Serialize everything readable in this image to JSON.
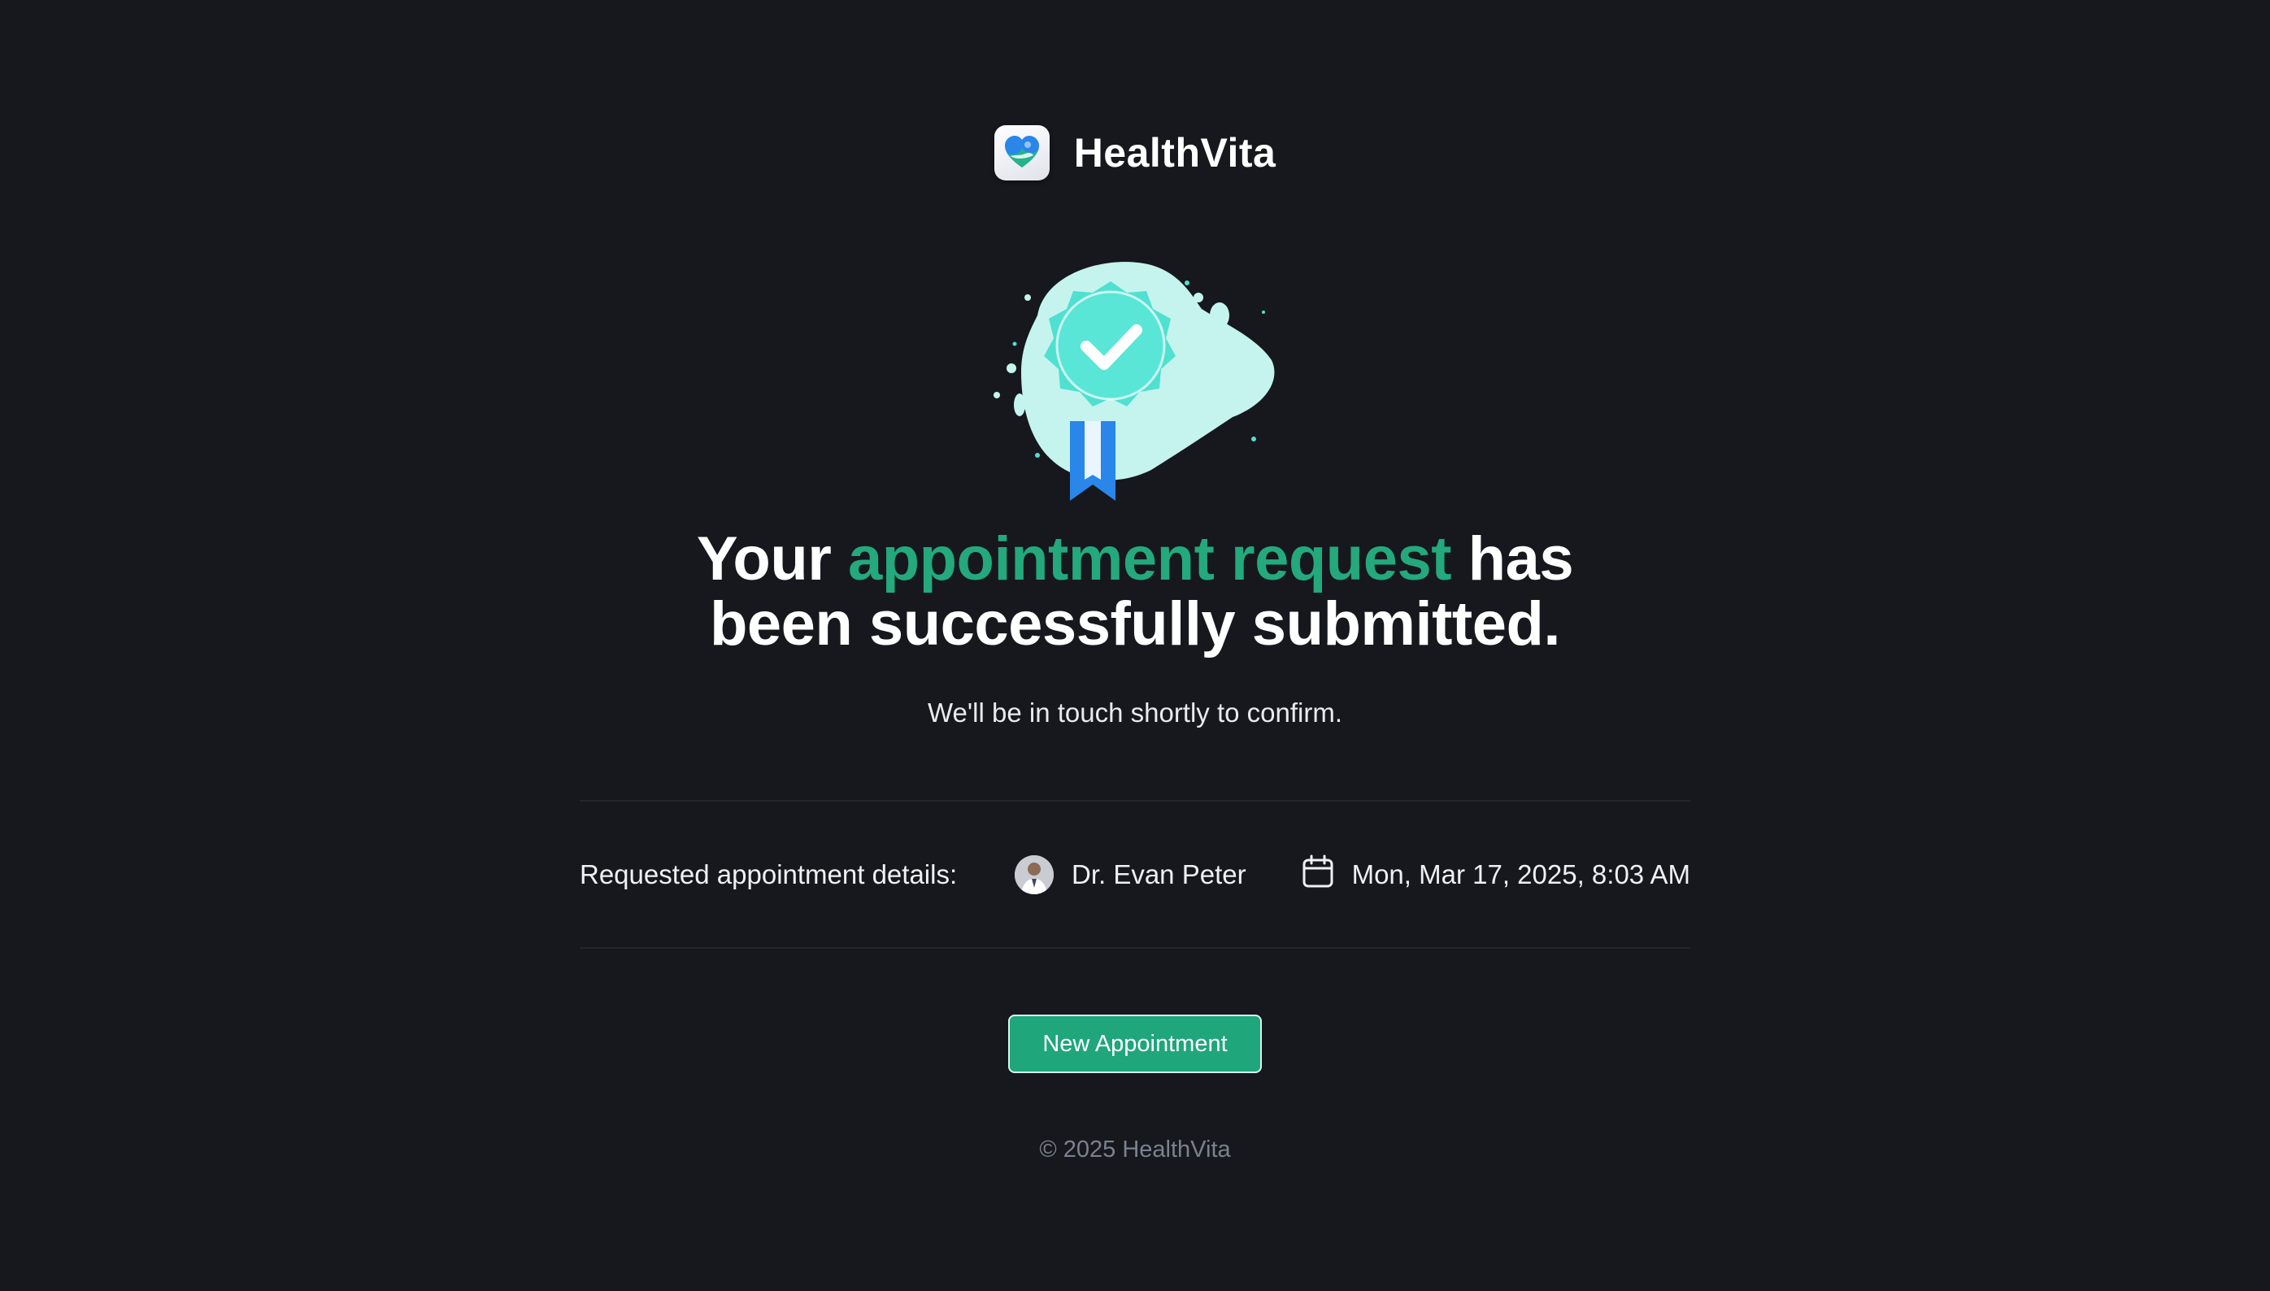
{
  "brand": {
    "name": "HealthVita",
    "logo_icon": "heart-hand-icon"
  },
  "badge": {
    "icon": "verified-ribbon-badge-icon",
    "colors": {
      "blob": "#c5f4ee",
      "seal": "#4fe0d0",
      "ribbon": "#2a86e8"
    }
  },
  "headline": {
    "part1": "Your ",
    "accent": "appointment request",
    "part2": " has",
    "line2": "been successfully submitted.",
    "accent_color": "#23a97c"
  },
  "subtitle": "We'll be in touch shortly to confirm.",
  "details": {
    "label": "Requested appointment details:",
    "doctor": "Dr. Evan Peter",
    "doctor_icon": "doctor-avatar",
    "datetime": "Mon, Mar 17, 2025, 8:03 AM",
    "datetime_icon": "calendar-icon"
  },
  "actions": {
    "new_appointment": "New Appointment",
    "button_color": "#1fa67a"
  },
  "footer": {
    "copyright": "© 2025 HealthVita"
  }
}
